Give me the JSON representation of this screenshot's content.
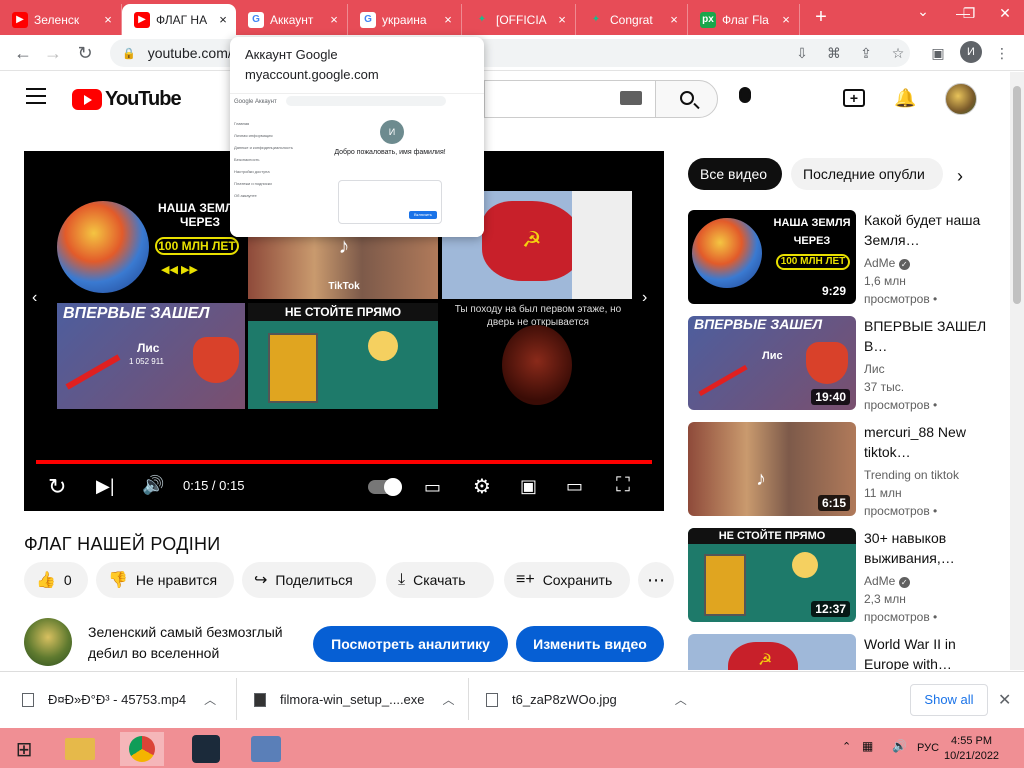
{
  "browser": {
    "tabs": [
      {
        "title": "Зеленск",
        "favicon": "youtube-icon",
        "active": false
      },
      {
        "title": "ФЛАГ НА",
        "favicon": "youtube-icon",
        "active": true
      },
      {
        "title": "Аккаунт",
        "favicon": "google-icon",
        "active": false
      },
      {
        "title": "украина",
        "favicon": "google-icon",
        "active": false
      },
      {
        "title": "[OFFICIA",
        "favicon": "mw-icon",
        "active": false
      },
      {
        "title": "Congrat",
        "favicon": "mw-icon",
        "active": false
      },
      {
        "title": "Флаг Fla",
        "favicon": "px-icon",
        "active": false
      }
    ],
    "url": "youtube.com/",
    "profile_initial": "И",
    "tabbar_color": "#e74c57"
  },
  "popup": {
    "title": "Аккаунт Google",
    "url": "myaccount.google.com",
    "preview": {
      "header": "Google Аккаунт",
      "avatar": "И",
      "welcome": "Добро пожаловать, имя фамилия!",
      "menu": [
        "Главная",
        "Личная информация",
        "Данные и конфиденциальность",
        "Безопасность",
        "Настройки доступа",
        "Платежи и подписки",
        "Об аккаунте"
      ],
      "button": "Включить"
    }
  },
  "youtube": {
    "logo_text": "YouTube",
    "player": {
      "endscreen": [
        {
          "text": "НАША ЗЕМЛЯ ЧЕРЕЗ",
          "badge": "100 МЛН ЛЕТ"
        },
        {
          "text": "TikTok"
        },
        {
          "text": ""
        },
        {
          "text": "ВПЕРВЫЕ ЗАШЕЛ",
          "sub": "Лис",
          "count": "1 052 911"
        },
        {
          "text": "НЕ СТОЙТЕ ПРЯМО"
        },
        {
          "text": "Ты походу на был первом этаже, но дверь не открывается"
        }
      ],
      "time": "0:15 / 0:15",
      "progress": 1.0
    },
    "video_title": "ФЛАГ НАШЕЙ РОДІНИ",
    "actions": {
      "like_count": "0",
      "dislike_label": "Не нравится",
      "share_label": "Поделиться",
      "download_label": "Скачать",
      "save_label": "Сохранить",
      "more_label": "⋯"
    },
    "channel": {
      "name": "Зеленский самый безмозглый дебил во вселенной",
      "analytics_button": "Посмотреть аналитику",
      "edit_button": "Изменить видео"
    },
    "chips": [
      "Все видео",
      "Последние опубли"
    ],
    "recommendations": [
      {
        "title": "Какой будет наша Земля…",
        "channel": "AdMe",
        "verified": true,
        "views": "1,6 млн",
        "when": "просмотров •",
        "duration": "9:29"
      },
      {
        "title": "ВПЕРВЫЕ ЗАШЕЛ В…",
        "channel": "Лис",
        "verified": false,
        "views": "37 тыс.",
        "when": "просмотров •",
        "duration": "19:40"
      },
      {
        "title": "mercuri_88 New tiktok…",
        "channel": "Trending on tiktok",
        "verified": false,
        "views": "11 млн",
        "when": "просмотров •",
        "duration": "6:15"
      },
      {
        "title": "30+ навыков выживания,…",
        "channel": "AdMe",
        "verified": true,
        "views": "2,3 млн",
        "when": "просмотров •",
        "duration": "12:37"
      },
      {
        "title": "World War II in Europe with…",
        "channel": "",
        "verified": false,
        "views": "",
        "when": "",
        "duration": ""
      }
    ]
  },
  "downloads": {
    "items": [
      {
        "name": "Ð¤Ð»Ð°Ð³ - 45753.mp4"
      },
      {
        "name": "filmora-win_setup_....exe"
      },
      {
        "name": "t6_zaP8zWOo.jpg"
      }
    ],
    "show_all": "Show all"
  },
  "taskbar": {
    "lang": "РУС",
    "time": "4:55 PM",
    "date": "10/21/2022"
  }
}
